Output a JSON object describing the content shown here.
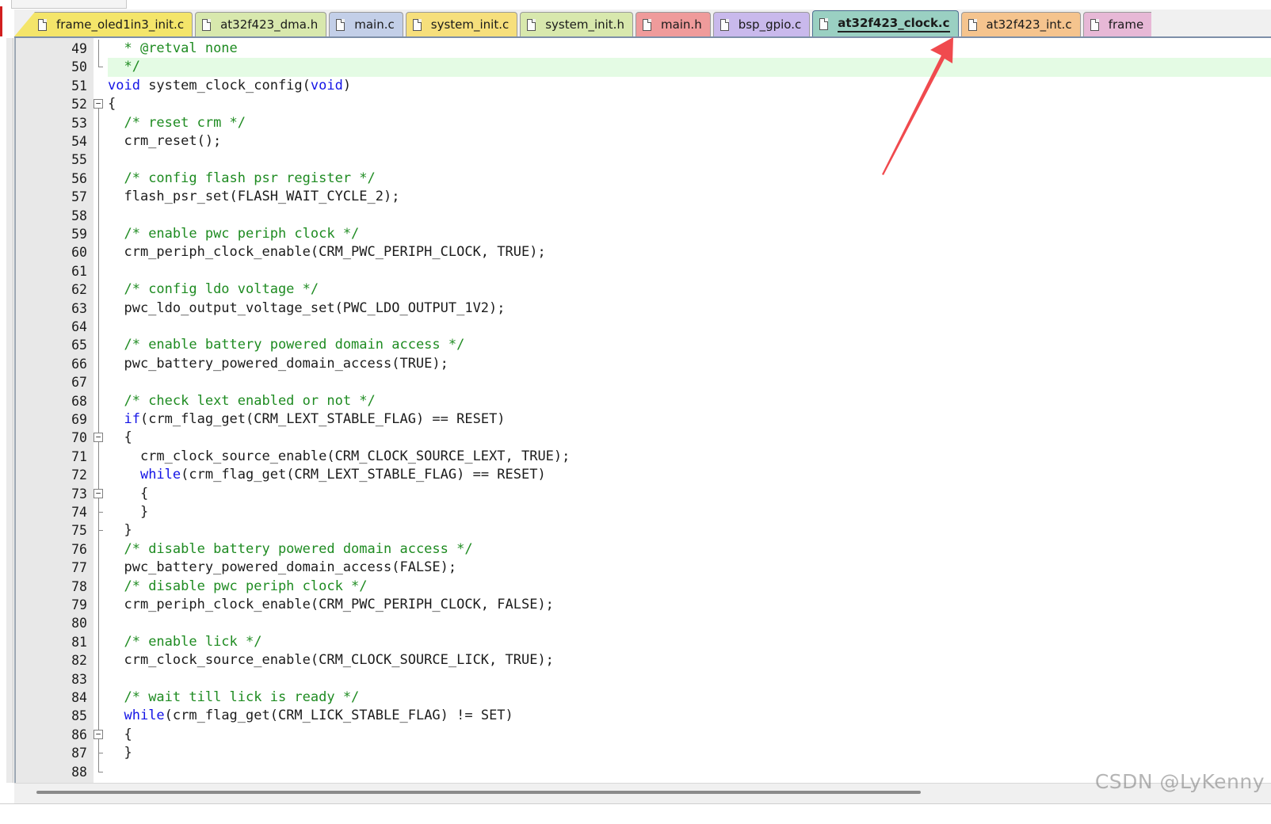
{
  "tabs": [
    {
      "label": "frame_oled1in3_init.c",
      "color": "#f4e56a",
      "active": false
    },
    {
      "label": "at32f423_dma.h",
      "color": "#d8e8ad",
      "active": false
    },
    {
      "label": "main.c",
      "color": "#c3cfe8",
      "active": false
    },
    {
      "label": "system_init.c",
      "color": "#f6df7c",
      "active": false
    },
    {
      "label": "system_init.h",
      "color": "#d8e8ad",
      "active": false
    },
    {
      "label": "main.h",
      "color": "#ef9b9b",
      "active": false
    },
    {
      "label": "bsp_gpio.c",
      "color": "#c9b9ec",
      "active": false
    },
    {
      "label": "at32f423_clock.c",
      "color": "#9ad0c2",
      "active": true
    },
    {
      "label": "at32f423_int.c",
      "color": "#f5c48e",
      "active": false
    },
    {
      "label": "frame",
      "color": "#e7b8d6",
      "active": false
    }
  ],
  "editor": {
    "lines": [
      {
        "n": "49",
        "fold": "vline",
        "segs": [
          {
            "t": "  "
          },
          {
            "t": "* @retval none",
            "k": "comment"
          }
        ]
      },
      {
        "n": "50",
        "fold": "end",
        "hl": true,
        "segs": [
          {
            "t": "  "
          },
          {
            "t": "*/",
            "k": "comment"
          }
        ]
      },
      {
        "n": "51",
        "fold": "",
        "segs": [
          {
            "t": "void",
            "k": "kw"
          },
          {
            "t": " system_clock_config("
          },
          {
            "t": "void",
            "k": "kw"
          },
          {
            "t": ")"
          }
        ]
      },
      {
        "n": "52",
        "fold": "box",
        "segs": [
          {
            "t": "{"
          }
        ]
      },
      {
        "n": "53",
        "fold": "vline",
        "segs": [
          {
            "t": "  "
          },
          {
            "t": "/* reset crm */",
            "k": "comment"
          }
        ]
      },
      {
        "n": "54",
        "fold": "vline",
        "segs": [
          {
            "t": "  crm_reset();"
          }
        ]
      },
      {
        "n": "55",
        "fold": "vline",
        "segs": [
          {
            "t": ""
          }
        ]
      },
      {
        "n": "56",
        "fold": "vline",
        "segs": [
          {
            "t": "  "
          },
          {
            "t": "/* config flash psr register */",
            "k": "comment"
          }
        ]
      },
      {
        "n": "57",
        "fold": "vline",
        "segs": [
          {
            "t": "  flash_psr_set(FLASH_WAIT_CYCLE_2);"
          }
        ]
      },
      {
        "n": "58",
        "fold": "vline",
        "segs": [
          {
            "t": ""
          }
        ]
      },
      {
        "n": "59",
        "fold": "vline",
        "segs": [
          {
            "t": "  "
          },
          {
            "t": "/* enable pwc periph clock */",
            "k": "comment"
          }
        ]
      },
      {
        "n": "60",
        "fold": "vline",
        "segs": [
          {
            "t": "  crm_periph_clock_enable(CRM_PWC_PERIPH_CLOCK, TRUE);"
          }
        ]
      },
      {
        "n": "61",
        "fold": "vline",
        "segs": [
          {
            "t": ""
          }
        ]
      },
      {
        "n": "62",
        "fold": "vline",
        "segs": [
          {
            "t": "  "
          },
          {
            "t": "/* config ldo voltage */",
            "k": "comment"
          }
        ]
      },
      {
        "n": "63",
        "fold": "vline",
        "segs": [
          {
            "t": "  pwc_ldo_output_voltage_set(PWC_LDO_OUTPUT_1V2);"
          }
        ]
      },
      {
        "n": "64",
        "fold": "vline",
        "segs": [
          {
            "t": ""
          }
        ]
      },
      {
        "n": "65",
        "fold": "vline",
        "segs": [
          {
            "t": "  "
          },
          {
            "t": "/* enable battery powered domain access */",
            "k": "comment"
          }
        ]
      },
      {
        "n": "66",
        "fold": "vline",
        "segs": [
          {
            "t": "  pwc_battery_powered_domain_access(TRUE);"
          }
        ]
      },
      {
        "n": "67",
        "fold": "vline",
        "segs": [
          {
            "t": ""
          }
        ]
      },
      {
        "n": "68",
        "fold": "vline",
        "segs": [
          {
            "t": "  "
          },
          {
            "t": "/* check lext enabled or not */",
            "k": "comment"
          }
        ]
      },
      {
        "n": "69",
        "fold": "vline",
        "segs": [
          {
            "t": "  "
          },
          {
            "t": "if",
            "k": "kw"
          },
          {
            "t": "(crm_flag_get(CRM_LEXT_STABLE_FLAG) == RESET)"
          }
        ]
      },
      {
        "n": "70",
        "fold": "box",
        "segs": [
          {
            "t": "  {"
          }
        ]
      },
      {
        "n": "71",
        "fold": "vline",
        "segs": [
          {
            "t": "    crm_clock_source_enable(CRM_CLOCK_SOURCE_LEXT, TRUE);"
          }
        ]
      },
      {
        "n": "72",
        "fold": "vline",
        "segs": [
          {
            "t": "    "
          },
          {
            "t": "while",
            "k": "kw"
          },
          {
            "t": "(crm_flag_get(CRM_LEXT_STABLE_FLAG) == RESET)"
          }
        ]
      },
      {
        "n": "73",
        "fold": "box",
        "segs": [
          {
            "t": "    {"
          }
        ]
      },
      {
        "n": "74",
        "fold": "endfull",
        "segs": [
          {
            "t": "    }"
          }
        ]
      },
      {
        "n": "75",
        "fold": "endfull",
        "segs": [
          {
            "t": "  }"
          }
        ]
      },
      {
        "n": "76",
        "fold": "vline",
        "segs": [
          {
            "t": "  "
          },
          {
            "t": "/* disable battery powered domain access */",
            "k": "comment"
          }
        ]
      },
      {
        "n": "77",
        "fold": "vline",
        "segs": [
          {
            "t": "  pwc_battery_powered_domain_access(FALSE);"
          }
        ]
      },
      {
        "n": "78",
        "fold": "vline",
        "segs": [
          {
            "t": "  "
          },
          {
            "t": "/* disable pwc periph clock */",
            "k": "comment"
          }
        ]
      },
      {
        "n": "79",
        "fold": "vline",
        "segs": [
          {
            "t": "  crm_periph_clock_enable(CRM_PWC_PERIPH_CLOCK, FALSE);"
          }
        ]
      },
      {
        "n": "80",
        "fold": "vline",
        "segs": [
          {
            "t": ""
          }
        ]
      },
      {
        "n": "81",
        "fold": "vline",
        "segs": [
          {
            "t": "  "
          },
          {
            "t": "/* enable lick */",
            "k": "comment"
          }
        ]
      },
      {
        "n": "82",
        "fold": "vline",
        "segs": [
          {
            "t": "  crm_clock_source_enable(CRM_CLOCK_SOURCE_LICK, TRUE);"
          }
        ]
      },
      {
        "n": "83",
        "fold": "vline",
        "segs": [
          {
            "t": ""
          }
        ]
      },
      {
        "n": "84",
        "fold": "vline",
        "segs": [
          {
            "t": "  "
          },
          {
            "t": "/* wait till lick is ready */",
            "k": "comment"
          }
        ]
      },
      {
        "n": "85",
        "fold": "vline",
        "segs": [
          {
            "t": "  "
          },
          {
            "t": "while",
            "k": "kw"
          },
          {
            "t": "(crm_flag_get(CRM_LICK_STABLE_FLAG) != SET)"
          }
        ]
      },
      {
        "n": "86",
        "fold": "box",
        "segs": [
          {
            "t": "  {"
          }
        ]
      },
      {
        "n": "87",
        "fold": "endfull",
        "segs": [
          {
            "t": "  }"
          }
        ]
      },
      {
        "n": "88",
        "fold": "endfull",
        "segs": [
          {
            "t": ""
          }
        ]
      }
    ]
  },
  "watermark": "CSDN @LyKenny",
  "colors": {
    "comment": "#1e8b21",
    "keyword": "#1414e6",
    "highlight_line": "#e4fbe4",
    "annotation_arrow": "#f04a4e"
  }
}
